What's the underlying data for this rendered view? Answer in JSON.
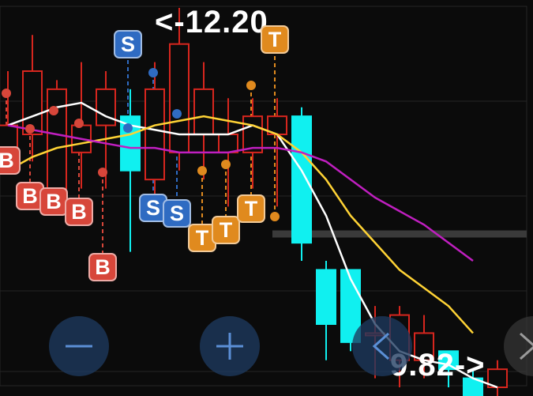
{
  "chart_data": {
    "type": "candlestick",
    "ylim": [
      9.0,
      13.2
    ],
    "grid": true,
    "candles": [
      {
        "o": 11.6,
        "c": 11.9,
        "h": 12.5,
        "l": 11.5
      },
      {
        "o": 11.8,
        "c": 12.5,
        "h": 12.9,
        "l": 11.5
      },
      {
        "o": 11.2,
        "c": 12.3,
        "h": 12.4,
        "l": 11.1
      },
      {
        "o": 11.6,
        "c": 11.9,
        "h": 12.6,
        "l": 11.2
      },
      {
        "o": 11.9,
        "c": 12.3,
        "h": 12.5,
        "l": 11.2
      },
      {
        "o": 12.0,
        "c": 11.4,
        "h": 12.3,
        "l": 10.5
      },
      {
        "o": 11.3,
        "c": 12.3,
        "h": 12.6,
        "l": 11.1
      },
      {
        "o": 11.6,
        "c": 12.8,
        "h": 13.2,
        "l": 11.4
      },
      {
        "o": 11.8,
        "c": 12.3,
        "h": 12.6,
        "l": 11.3
      },
      {
        "o": 11.6,
        "c": 11.8,
        "h": 12.2,
        "l": 11.0
      },
      {
        "o": 11.6,
        "c": 12.0,
        "h": 12.2,
        "l": 11.2
      },
      {
        "o": 11.8,
        "c": 12.0,
        "h": 12.2,
        "l": 11.0
      },
      {
        "o": 12.0,
        "c": 10.6,
        "h": 12.1,
        "l": 10.4
      },
      {
        "o": 10.3,
        "c": 9.7,
        "h": 10.4,
        "l": 9.3
      },
      {
        "o": 10.3,
        "c": 9.5,
        "h": 10.3,
        "l": 9.4
      },
      {
        "o": 9.6,
        "c": 9.6,
        "h": 9.9,
        "l": 9.1
      },
      {
        "o": 9.3,
        "c": 9.8,
        "h": 9.9,
        "l": 9.0
      },
      {
        "o": 9.3,
        "c": 9.6,
        "h": 9.8,
        "l": 9.1
      },
      {
        "o": 9.4,
        "c": 9.2,
        "h": 9.4,
        "l": 9.0
      },
      {
        "o": 9.1,
        "c": 8.9,
        "h": 9.2,
        "l": 8.8
      },
      {
        "o": 9.0,
        "c": 9.2,
        "h": 9.3,
        "l": 8.9
      }
    ],
    "lines": [
      {
        "color": "#ffffff",
        "values": [
          11.9,
          12.0,
          12.1,
          12.15,
          12.0,
          11.9,
          11.85,
          11.8,
          11.8,
          11.8,
          11.9,
          11.8,
          11.4,
          10.9,
          10.2,
          9.7,
          9.4,
          9.3,
          9.25,
          9.1,
          9.0
        ]
      },
      {
        "color": "#ffd335",
        "values": [
          11.4,
          11.55,
          11.65,
          11.7,
          11.75,
          11.8,
          11.9,
          11.95,
          12.0,
          11.95,
          11.9,
          11.8,
          11.6,
          11.3,
          10.9,
          10.6,
          10.3,
          10.1,
          9.9,
          9.6
        ]
      },
      {
        "color": "#c01fc0",
        "values": [
          11.9,
          11.85,
          11.8,
          11.75,
          11.7,
          11.65,
          11.65,
          11.6,
          11.6,
          11.6,
          11.65,
          11.65,
          11.6,
          11.5,
          11.3,
          11.1,
          10.95,
          10.8,
          10.6,
          10.4
        ]
      }
    ],
    "annotations": {
      "high_label": "<-12.20",
      "low_label": "9.82->"
    },
    "signals": [
      {
        "kind": "B",
        "candle": 2,
        "color": "#d7463a"
      },
      {
        "kind": "B",
        "candle": 3,
        "color": "#d7463a"
      },
      {
        "kind": "B",
        "candle": 4,
        "color": "#d7463a"
      },
      {
        "kind": "B",
        "candle": 7,
        "color": "#d7463a"
      },
      {
        "kind": "B",
        "candle": 10,
        "color": "#d7463a"
      },
      {
        "kind": "S",
        "candle": 5,
        "color": "#2f6bc2"
      },
      {
        "kind": "S",
        "candle": 6,
        "color": "#2f6bc2"
      },
      {
        "kind": "S",
        "candle": 11,
        "color": "#2f6bc2"
      },
      {
        "kind": "T",
        "candle": 0,
        "color": "#e08a1e"
      },
      {
        "kind": "T",
        "candle": 1,
        "color": "#e08a1e"
      },
      {
        "kind": "T",
        "candle": 8,
        "color": "#e08a1e"
      },
      {
        "kind": "T",
        "candle": 9,
        "color": "#e08a1e"
      }
    ]
  },
  "controls": {
    "zoom_out_icon": "minus-icon",
    "zoom_in_icon": "plus-icon",
    "prev_icon": "chevron-left-icon",
    "next_icon": "chevron-right-icon"
  }
}
